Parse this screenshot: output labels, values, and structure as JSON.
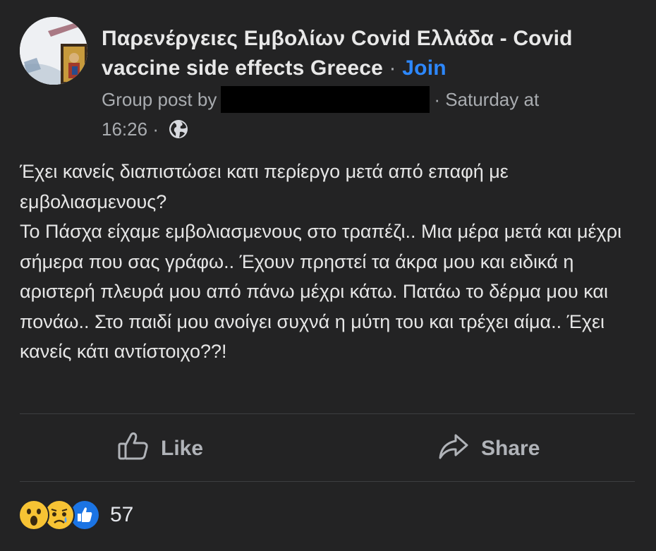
{
  "header": {
    "group_name": "Παρενέργειες Εμβολίων Covid  Ελλάδα - Covid vaccine side effects  Greece",
    "separator": "·",
    "join_label": "Join",
    "post_meta_prefix": "Group post by",
    "post_day": "· Saturday at",
    "post_time": "16:26",
    "privacy_separator": "·",
    "privacy_icon": "globe-icon"
  },
  "post": {
    "body": "Έχει κανείς διαπιστώσει κατι περίεργο μετά από επαφή με εμβολιασμενους?\nΤο Πάσχα είχαμε εμβολιασμενους στο τραπέζι.. Μια μέρα μετά και μέχρι σήμερα που σας γράφω.. Έχουν πρηστεί τα άκρα μου και ειδικά η αριστερή πλευρά μου από πάνω μέχρι κάτω.  Πατάω το δέρμα μου και πονάω.. Στο παιδί μου ανοίγει συχνά η μύτη του και τρέχει αίμα.. Έχει κανείς κάτι αντίστοιχο??!"
  },
  "actions": {
    "like_label": "Like",
    "share_label": "Share"
  },
  "reactions": {
    "icons": [
      "wow-reaction-icon",
      "sad-reaction-icon",
      "like-reaction-icon"
    ],
    "count": "57"
  },
  "colors": {
    "background": "#232324",
    "link_blue": "#2d88ff",
    "secondary_text": "#a9acb0"
  }
}
